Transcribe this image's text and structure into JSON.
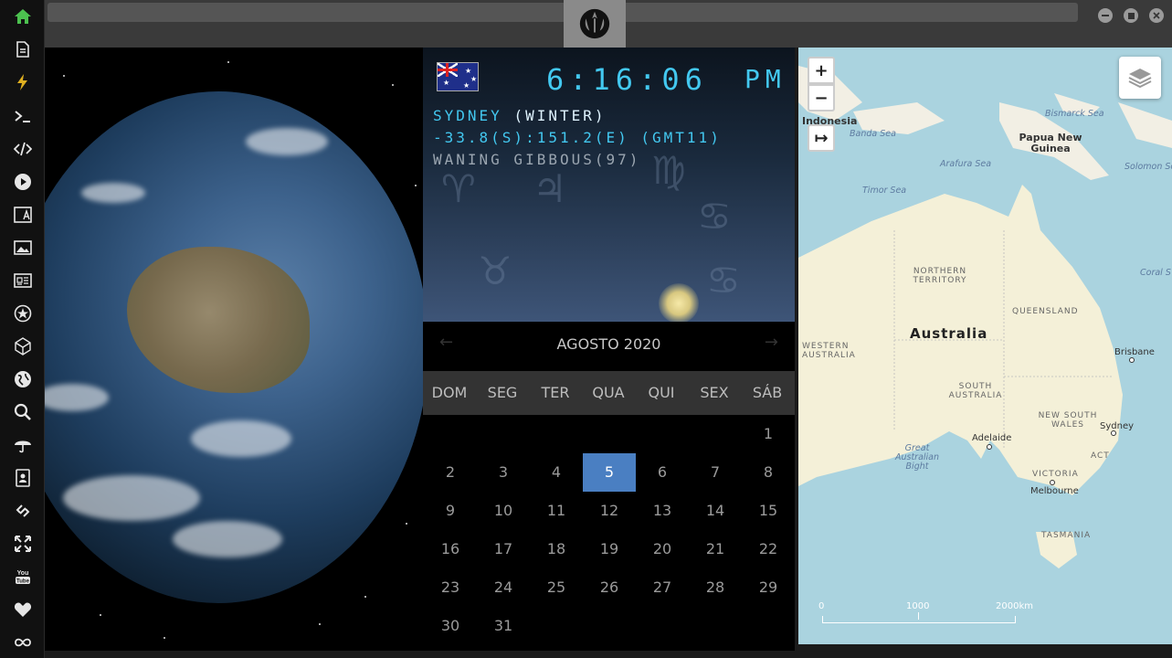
{
  "sidebar": {
    "items": [
      {
        "icon": "home-icon"
      },
      {
        "icon": "document-icon"
      },
      {
        "icon": "lightning-icon"
      },
      {
        "icon": "terminal-icon"
      },
      {
        "icon": "code-icon"
      },
      {
        "icon": "play-icon"
      },
      {
        "icon": "translate-icon"
      },
      {
        "icon": "image-icon"
      },
      {
        "icon": "news-icon"
      },
      {
        "icon": "sheriff-icon"
      },
      {
        "icon": "polyhedron-icon"
      },
      {
        "icon": "globe-icon"
      },
      {
        "icon": "search-icon"
      },
      {
        "icon": "umbrella-icon"
      },
      {
        "icon": "contacts-icon"
      },
      {
        "icon": "link-icon"
      },
      {
        "icon": "expand-icon"
      },
      {
        "icon": "youtube-icon"
      },
      {
        "icon": "heart-icon"
      },
      {
        "icon": "infinity-icon"
      }
    ],
    "active_color": "#4cc14f"
  },
  "window": {
    "controls": [
      "minimize",
      "maximize",
      "close"
    ]
  },
  "clock": {
    "time": "6:16:06",
    "ampm": "PM",
    "city": "SYDNEY",
    "season": "(WINTER)",
    "coords": "-33.8(S):151.2(E) (GMT11)",
    "moon_phase": "WANING GIBBOUS(97)",
    "accent_color": "#43c8f0"
  },
  "calendar": {
    "month_label": "AGOSTO 2020",
    "weekdays": [
      "DOM",
      "SEG",
      "TER",
      "QUA",
      "QUI",
      "SEX",
      "SÁB"
    ],
    "weeks": [
      [
        "",
        "",
        "",
        "",
        "",
        "",
        "1"
      ],
      [
        "2",
        "3",
        "4",
        "5",
        "6",
        "7",
        "8"
      ],
      [
        "9",
        "10",
        "11",
        "12",
        "13",
        "14",
        "15"
      ],
      [
        "16",
        "17",
        "18",
        "19",
        "20",
        "21",
        "22"
      ],
      [
        "23",
        "24",
        "25",
        "26",
        "27",
        "28",
        "29"
      ],
      [
        "30",
        "31",
        "",
        "",
        "",
        "",
        ""
      ]
    ],
    "today": "5",
    "highlight_color": "#4a7fc2"
  },
  "map": {
    "zoom_in": "+",
    "zoom_out": "−",
    "fit_symbol": "↦",
    "labels": {
      "indonesia": "Indonesia",
      "banda_sea": "Banda Sea",
      "bismarck_sea": "Bismarck Sea",
      "papua": "Papua New Guinea",
      "arafura_sea": "Arafura Sea",
      "solomon_sea": "Solomon Se",
      "timor_sea": "Timor Sea",
      "coral_sea": "Coral S",
      "northern_territory": "NORTHERN TERRITORY",
      "queensland": "QUEENSLAND",
      "western_australia": "WESTERN AUSTRALIA",
      "australia": "Australia",
      "south_australia": "SOUTH AUSTRALIA",
      "new_south_wales": "NEW SOUTH WALES",
      "brisbane": "Brisbane",
      "sydney": "Sydney",
      "adelaide": "Adelaide",
      "great_bight": "Great Australian Bight",
      "act": "ACT",
      "victoria": "VICTORIA",
      "melbourne": "Melbourne",
      "tasmania": "TASMANIA"
    },
    "scale": {
      "s0": "0",
      "s1": "1000",
      "s2": "2000km"
    }
  }
}
